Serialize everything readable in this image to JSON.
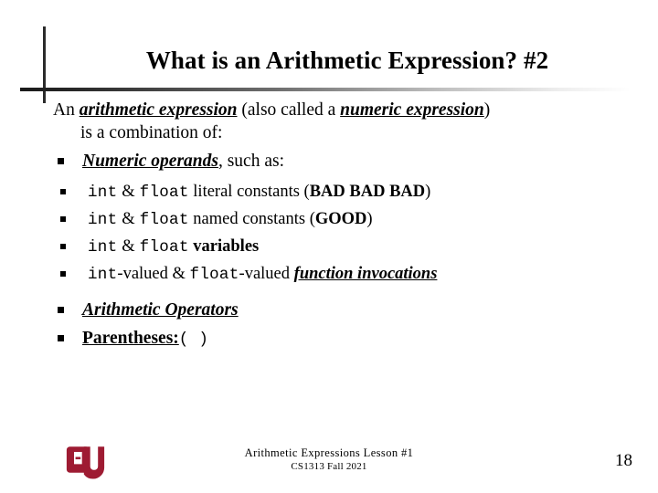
{
  "slide": {
    "title": "What is an Arithmetic Expression? #2",
    "lead": {
      "part1": "An ",
      "em1": "arithmetic expression",
      "part2": " (also called a ",
      "em2": "numeric expression",
      "part3": ")",
      "continuation": "is a combination of:"
    },
    "bullets": [
      {
        "bullet_glyph": "square-bullet",
        "em": "Numeric operands",
        "tail": ", such as:",
        "children": [
          {
            "bullet_glyph": "square-bullet",
            "code1": "int",
            "amp": " & ",
            "code2": "float",
            "text": " literal constants (",
            "emphasis": "BAD BAD BAD",
            "tail": ")"
          },
          {
            "bullet_glyph": "square-bullet",
            "code1": "int",
            "amp": " & ",
            "code2": "float",
            "text": " named constants (",
            "emphasis": "GOOD",
            "tail": ")"
          },
          {
            "bullet_glyph": "square-bullet",
            "code1": "int",
            "amp": " & ",
            "code2": "float",
            "text": " ",
            "emphasis": "variables",
            "tail": ""
          },
          {
            "bullet_glyph": "square-bullet",
            "code1": "int",
            "amp": "-valued & ",
            "code2": "float",
            "text": "-valued ",
            "emphasis": "function invocations",
            "tail": ""
          }
        ]
      },
      {
        "bullet_glyph": "square-bullet",
        "em": "Arithmetic Operators",
        "tail": ""
      },
      {
        "bullet_glyph": "square-bullet",
        "em": "Parentheses:",
        "paren_open": "(",
        "paren_spacer": "    ",
        "paren_close": ")"
      }
    ]
  },
  "footer": {
    "line1": "Arithmetic Expressions Lesson #1",
    "line2": "CS1313 Fall 2021",
    "page_number": "18",
    "logo_name": "ou-logo",
    "logo_color": "#9E1B32"
  },
  "colors": {
    "text": "#000000",
    "rule": "#2b2b2b",
    "logo_crimson": "#9E1B32",
    "background": "#ffffff"
  }
}
